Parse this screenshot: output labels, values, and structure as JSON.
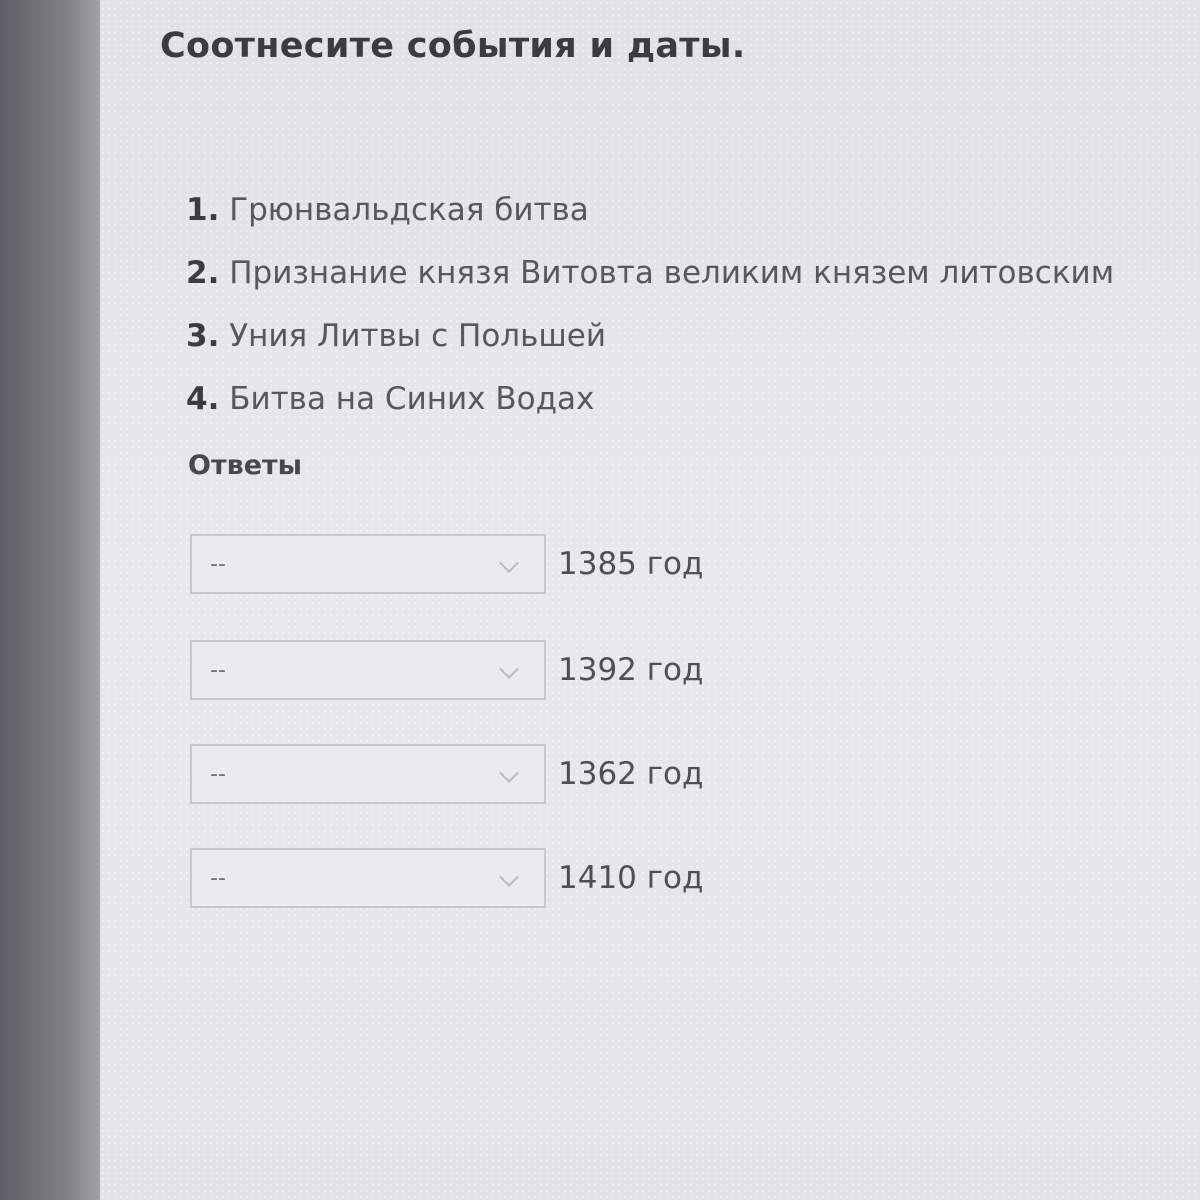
{
  "question": {
    "title": "Соотнесите события и даты."
  },
  "items": [
    {
      "num": "1.",
      "text": " Грюнвальдская битва"
    },
    {
      "num": "2.",
      "text": " Признание князя Витовта великим князем литовским"
    },
    {
      "num": "3.",
      "text": " Уния Литвы с Польшей"
    },
    {
      "num": "4.",
      "text": " Битва на Синих Водах"
    }
  ],
  "answers": {
    "label": "Ответы",
    "rows": [
      {
        "selected": "--",
        "year": "1385 год"
      },
      {
        "selected": "--",
        "year": "1392 год"
      },
      {
        "selected": "--",
        "year": "1362 год"
      },
      {
        "selected": "--",
        "year": "1410 год"
      }
    ]
  },
  "icons": {
    "dropdown": "chevron-down-icon"
  }
}
